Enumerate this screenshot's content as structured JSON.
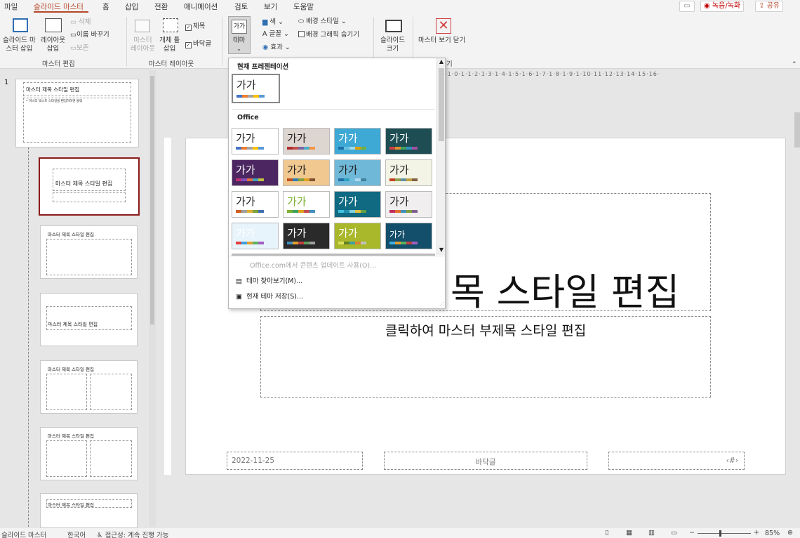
{
  "tabs": [
    "파일",
    "슬라이드 마스터",
    "홈",
    "삽입",
    "전환",
    "애니메이션",
    "검토",
    "보기",
    "도움말"
  ],
  "top_right": {
    "record": "녹음/녹화",
    "share": "공유"
  },
  "ribbon": {
    "insert_master": "슬라이드 마\n스터 삽입",
    "insert_layout": "레이아웃\n삽입",
    "delete": "삭제",
    "rename": "이름 바꾸기",
    "preserve": "보존",
    "group_master_edit": "마스터 편집",
    "master_layout": "마스터\n레이아웃",
    "insert_placeholder": "개체 틀\n삽입",
    "title_check": "제목",
    "footer_check": "바닥글",
    "group_master_layout": "마스터 레이아웃",
    "theme": "테마",
    "colors": "색",
    "fonts": "글꼴",
    "effects": "효과",
    "background_styles": "배경 스타일",
    "hide_bg_graphics": "배경 그래픽 숨기기",
    "slide_size": "슬라이드\n크기",
    "close_master": "마스터 보기 닫기"
  },
  "gallery": {
    "section_current": "현재 프레젠테이션",
    "section_office": "Office",
    "theme_label": "가가",
    "menu_update": "Office.com에서 콘텐츠 업데이트 사용(O)...",
    "menu_browse": "테마 찾아보기(M)...",
    "menu_save": "현재 테마 저장(S)..."
  },
  "thumbnails": {
    "master_title": "마스터 제목 스타일 편집",
    "master_body": "• 마스터 텍스트 스타일을 편집하려면 클릭",
    "slide_number": "1"
  },
  "slide": {
    "title_visible": "목 스타일 편집",
    "subtitle": "클릭하여 마스터 부제목 스타일 편집",
    "date": "2022-11-25",
    "footer": "바닥글",
    "slide_num": "‹#›"
  },
  "statusbar": {
    "view": "슬라이드 마스터",
    "language": "한국어",
    "accessibility": "접근성: 계속 진행 가능",
    "zoom": "85%"
  }
}
